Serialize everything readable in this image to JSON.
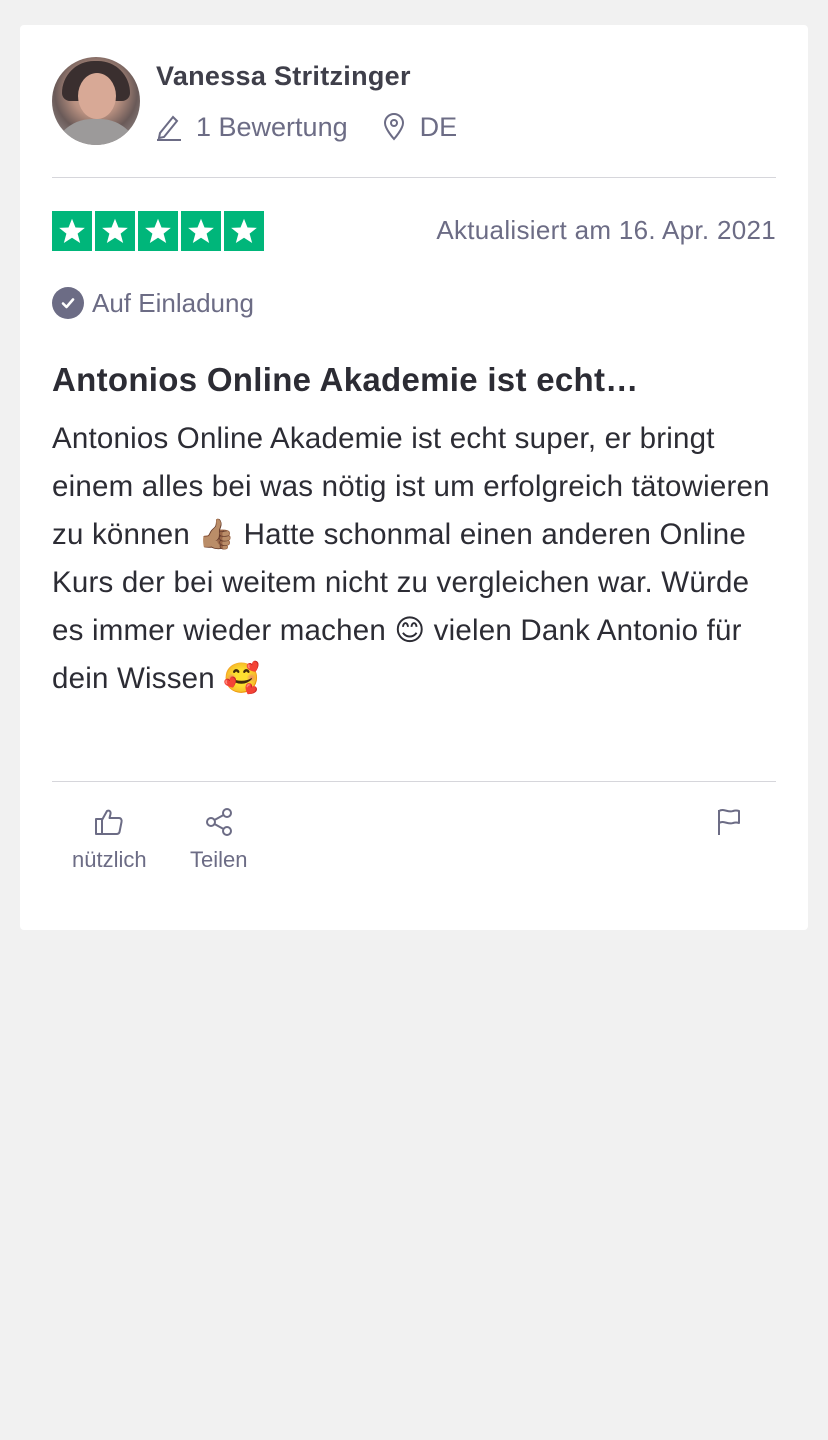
{
  "reviewer": {
    "name": "Vanessa Stritzinger",
    "review_count": "1 Bewertung",
    "country": "DE"
  },
  "rating": {
    "stars": 5,
    "star_color": "#00b67a",
    "date": "Aktualisiert am 16. Apr. 2021",
    "invite_label": "Auf Einladung"
  },
  "review": {
    "title": "Antonios Online Akademie ist echt…",
    "body": "Antonios Online Akademie ist echt super, er bringt einem alles bei was nötig ist um erfolgreich tätowieren zu können 👍🏽 Hatte schonmal einen anderen Online Kurs der bei weitem nicht zu vergleichen war. Würde es immer wieder machen 😊 vielen Dank Antonio für dein Wissen 🥰"
  },
  "actions": {
    "useful_label": "nützlich",
    "share_label": "Teilen"
  },
  "icons": {
    "review_count": "pencil-icon",
    "country": "location-pin-icon",
    "verified": "check-circle-icon",
    "useful": "thumbs-up-icon",
    "share": "share-icon",
    "report": "flag-icon"
  },
  "colors": {
    "background": "#f1f1f1",
    "card": "#ffffff",
    "muted_text": "#6c6c85",
    "text": "#2c2c34"
  }
}
